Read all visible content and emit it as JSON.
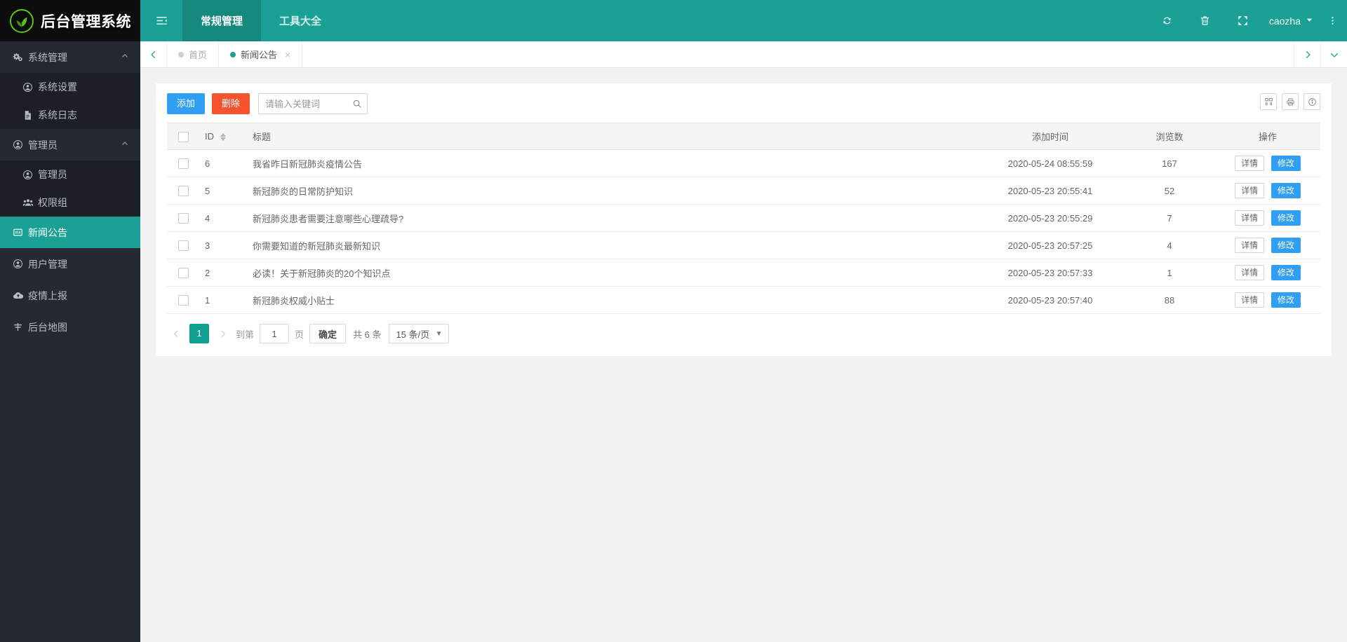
{
  "brand": {
    "title": "后台管理系统",
    "logo_icon": "leaf-sprout-logo"
  },
  "sidebar": {
    "groups": [
      {
        "label": "系统管理",
        "icon": "gears-icon",
        "expanded": true,
        "children": [
          {
            "label": "系统设置",
            "icon": "user-circle-icon"
          },
          {
            "label": "系统日志",
            "icon": "file-text-icon"
          }
        ]
      },
      {
        "label": "管理员",
        "icon": "user-circle-icon",
        "expanded": true,
        "children": [
          {
            "label": "管理员",
            "icon": "user-circle-icon"
          },
          {
            "label": "权限组",
            "icon": "users-group-icon"
          }
        ]
      }
    ],
    "items": [
      {
        "label": "新闻公告",
        "icon": "window-panel-icon",
        "active": true
      },
      {
        "label": "用户管理",
        "icon": "user-circle-icon",
        "active": false
      },
      {
        "label": "疫情上报",
        "icon": "cloud-upload-icon",
        "active": false
      },
      {
        "label": "后台地图",
        "icon": "signpost-icon",
        "active": false
      }
    ]
  },
  "topbar": {
    "collapse_icon": "menu-indent-icon",
    "tabs": [
      {
        "label": "常规管理",
        "active": true
      },
      {
        "label": "工具大全",
        "active": false
      }
    ],
    "icons": [
      {
        "name": "refresh-icon"
      },
      {
        "name": "trash-icon"
      },
      {
        "name": "fullscreen-icon"
      }
    ],
    "user": "caozha",
    "user_caret": "▼",
    "more_icon": "vertical-dots-icon"
  },
  "tabstrip": {
    "left_arrow": "chevron-left-icon",
    "right_arrow": "chevron-right-icon",
    "dropdown_arrow": "chevron-down-icon",
    "tabs": [
      {
        "label": "首页",
        "active": false,
        "closable": false
      },
      {
        "label": "新闻公告",
        "active": true,
        "closable": true,
        "close": "×"
      }
    ]
  },
  "toolbar": {
    "add_label": "添加",
    "delete_label": "删除",
    "search_placeholder": "请输入关键词",
    "search_value": "",
    "search_icon": "search-icon",
    "right_icons": [
      {
        "name": "columns-filter-icon"
      },
      {
        "name": "print-icon"
      },
      {
        "name": "info-circle-icon"
      }
    ]
  },
  "table": {
    "columns": [
      "",
      "ID",
      "标题",
      "添加时间",
      "浏览数",
      "操作"
    ],
    "sortable_column": "ID",
    "rows": [
      {
        "id": "6",
        "title": "我省昨日新冠肺炎疫情公告",
        "time": "2020-05-24 08:55:59",
        "views": "167",
        "detail": "详情",
        "edit": "修改"
      },
      {
        "id": "5",
        "title": "新冠肺炎的日常防护知识",
        "time": "2020-05-23 20:55:41",
        "views": "52",
        "detail": "详情",
        "edit": "修改"
      },
      {
        "id": "4",
        "title": "新冠肺炎患者需要注意哪些心理疏导?",
        "time": "2020-05-23 20:55:29",
        "views": "7",
        "detail": "详情",
        "edit": "修改"
      },
      {
        "id": "3",
        "title": "你需要知道的新冠肺炎最新知识",
        "time": "2020-05-23 20:57:25",
        "views": "4",
        "detail": "详情",
        "edit": "修改"
      },
      {
        "id": "2",
        "title": "必读！关于新冠肺炎的20个知识点",
        "time": "2020-05-23 20:57:33",
        "views": "1",
        "detail": "详情",
        "edit": "修改"
      },
      {
        "id": "1",
        "title": "新冠肺炎权威小贴士",
        "time": "2020-05-23 20:57:40",
        "views": "88",
        "detail": "详情",
        "edit": "修改"
      }
    ]
  },
  "pagination": {
    "prev_icon": "chevron-left-icon",
    "next_icon": "chevron-right-icon",
    "current_page": "1",
    "goto_label": "到第",
    "goto_value": "1",
    "page_unit": "页",
    "confirm_label": "确定",
    "total_label": "共 6 条",
    "page_size": "15 条/页",
    "page_size_caret": "▼"
  },
  "colors": {
    "brand_green": "#1aa094",
    "brand_green_dark": "#16897f",
    "sidebar_bg": "#252a30",
    "sidebar_sub_bg": "#1c2026",
    "logo_bg": "#0d0d0d",
    "accent_blue": "#2f9ef3",
    "accent_red": "#f7522f",
    "pager_active": "#0f9e90",
    "logo_green": "#5cc41c"
  }
}
